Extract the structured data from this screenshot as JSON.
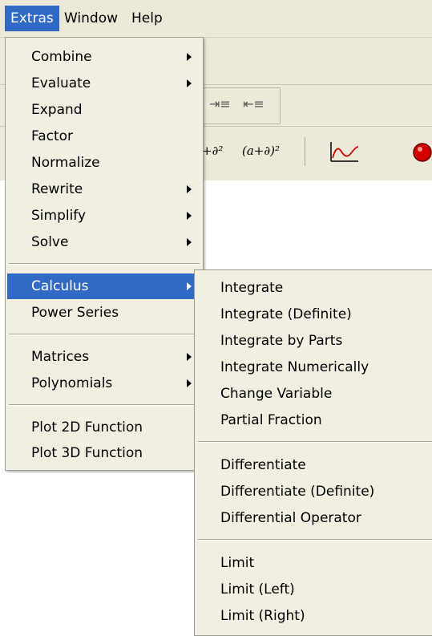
{
  "menubar": {
    "items": [
      "Extras",
      "Window",
      "Help"
    ]
  },
  "toolbar": {
    "expr1": "+∂²",
    "expr2": "(a+∂)²"
  },
  "extras_menu": {
    "items": {
      "combine": "Combine",
      "evaluate": "Evaluate",
      "expand": "Expand",
      "factor": "Factor",
      "normalize": "Normalize",
      "rewrite": "Rewrite",
      "simplify": "Simplify",
      "solve": "Solve",
      "calculus": "Calculus",
      "power_series": "Power Series",
      "matrices": "Matrices",
      "polynomials": "Polynomials",
      "plot2d": "Plot 2D Function",
      "plot3d": "Plot 3D Function"
    }
  },
  "calculus_menu": {
    "items": {
      "integrate": "Integrate",
      "integrate_definite": "Integrate (Definite)",
      "integrate_parts": "Integrate by Parts",
      "integrate_numerically": "Integrate Numerically",
      "change_variable": "Change Variable",
      "partial_fraction": "Partial Fraction",
      "differentiate": "Differentiate",
      "differentiate_definite": "Differentiate (Definite)",
      "differential_operator": "Differential Operator",
      "limit": "Limit",
      "limit_left": "Limit (Left)",
      "limit_right": "Limit (Right)"
    }
  },
  "colors": {
    "highlight": "#316ac5",
    "menu_bg": "#f1efe2",
    "bar_bg": "#ece9d8"
  }
}
